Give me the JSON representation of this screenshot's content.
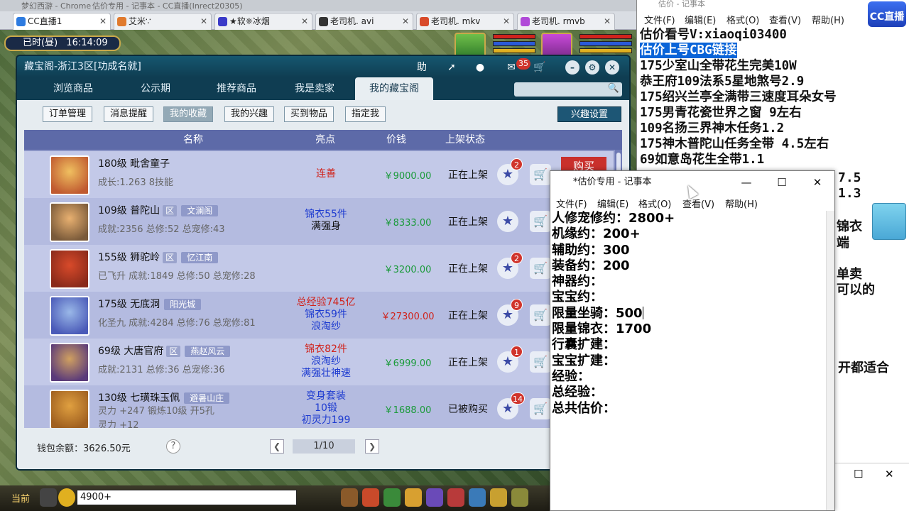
{
  "browser": {
    "top_strip": [
      "梦幻西游 - Chrome",
      "估价专用 - 记事本 - CC直播(Inrect20305)"
    ],
    "tabs": [
      {
        "label": "CC直播1",
        "active": true,
        "color": "#2d7be0"
      },
      {
        "label": "艾米∵",
        "active": false,
        "color": "#e07a2d"
      },
      {
        "label": "★软❈冰烟",
        "active": false,
        "color": "#3a3ac8"
      },
      {
        "label": "老司机. avi",
        "active": false,
        "color": "#333333"
      },
      {
        "label": "老司机. mkv",
        "active": false,
        "color": "#d84a2a"
      },
      {
        "label": "老司机. rmvb",
        "active": false,
        "color": "#b04ad8"
      }
    ]
  },
  "game_hud": {
    "time_label": "已时(昼)",
    "time_value": "16:14:09"
  },
  "cbg": {
    "title": "藏宝阁-浙江3区[功成名就]",
    "help_label": "助",
    "message_badge": "35",
    "nav_tabs": [
      "浏览商品",
      "公示期",
      "推荐商品",
      "我是卖家",
      "我的藏宝阁"
    ],
    "active_nav": 4,
    "sub_buttons": [
      "订单管理",
      "消息提醒",
      "我的收藏",
      "我的兴趣",
      "买到物品",
      "指定我"
    ],
    "active_sub": 2,
    "interest_button": "兴趣设置",
    "columns": [
      "名称",
      "亮点",
      "价钱",
      "上架状态"
    ],
    "buy_label": "购买",
    "rows": [
      {
        "name": "180级  毗舍童子",
        "school": "",
        "server": "",
        "stats": "成长:1.263  8技能",
        "highlights": [
          {
            "text": "连善",
            "color": "#d0231c"
          }
        ],
        "price": "￥9000.00",
        "price_color": "#1a9a3a",
        "status": "正在上架",
        "badge": "2",
        "buy": true
      },
      {
        "name": "109级  普陀山",
        "school": "区",
        "server": "文澜阁",
        "stats": "成就:2356  总修:52  总宠修:43",
        "highlights": [
          {
            "text": "锦衣55件",
            "color": "#1d3bd0"
          },
          {
            "text": "满强身",
            "color": "#111111"
          }
        ],
        "price": "￥8333.00",
        "price_color": "#1a9a3a",
        "status": "正在上架",
        "badge": "",
        "buy": false
      },
      {
        "name": "155级  狮驼岭",
        "school": "区",
        "server": "忆江南",
        "stats": "已飞升  成就:1849  总修:50  总宠修:28",
        "highlights": [],
        "price": "￥3200.00",
        "price_color": "#1a9a3a",
        "status": "正在上架",
        "badge": "2",
        "buy": false
      },
      {
        "name": "175级  无底洞",
        "school": "",
        "server": "阳光城",
        "stats": "化圣九  成就:4284  总修:76  总宠修:81",
        "highlights": [
          {
            "text": "总经验745亿",
            "color": "#d0231c"
          },
          {
            "text": "锦衣59件",
            "color": "#1d3bd0"
          },
          {
            "text": "浪淘纱",
            "color": "#1d3bd0"
          }
        ],
        "price": "￥27300.00",
        "price_color": "#d0231c",
        "status": "正在上架",
        "badge": "9",
        "buy": false
      },
      {
        "name": "69级  大唐官府",
        "school": "区",
        "server": "燕赵风云",
        "stats": "成就:2131  总修:36  总宠修:36",
        "highlights": [
          {
            "text": "锦衣82件",
            "color": "#d0231c"
          },
          {
            "text": "浪淘纱",
            "color": "#1d3bd0"
          },
          {
            "text": "满强壮神速",
            "color": "#1d3bd0"
          }
        ],
        "price": "￥6999.00",
        "price_color": "#1a9a3a",
        "status": "正在上架",
        "badge": "1",
        "buy": false
      },
      {
        "name": "130级  七璜珠玉佩",
        "school": "",
        "server": "避暑山庄",
        "stats": "灵力 +247  锻炼10级  开5孔",
        "stats2": "灵力 +12",
        "highlights": [
          {
            "text": "变身套装",
            "color": "#1d3bd0"
          },
          {
            "text": "10锻",
            "color": "#1d3bd0"
          },
          {
            "text": "初灵力199",
            "color": "#1d3bd0"
          }
        ],
        "price": "￥1688.00",
        "price_color": "#1a9a3a",
        "status": "已被购买",
        "badge": "14",
        "buy": false
      }
    ],
    "wallet": "钱包余额：3626.50元",
    "page": "1/10"
  },
  "chat": {
    "channel": "当前",
    "input_value": "4900+"
  },
  "big_notepad": {
    "title": "估价 - 记事本",
    "menu": [
      "文件(F)",
      "编辑(E)",
      "格式(O)",
      "查看(V)",
      "帮助(H)"
    ],
    "lines": [
      "估价看号V:xiaoqi03400",
      "估价上号CBG链接",
      "175少室山全带花生完美10W",
      "恭王府109法系5星地煞号2.9",
      "175绍兴兰亭全满带三速度耳朵女号",
      "175男青花瓷世界之窗  9左右",
      "109名扬三界神木任务1.2",
      "175神木普陀山任务全带 4.5左右",
      "69如意岛花生全带1.1"
    ],
    "fragments": [
      "7.5",
      "1.3",
      "锦衣",
      "端",
      "单卖",
      "可以的",
      "开都适合"
    ],
    "logo": "CC直播"
  },
  "notepad": {
    "title": "*估价专用 - 记事本",
    "menu": [
      "文件(F)",
      "编辑(E)",
      "格式(O)",
      "查看(V)",
      "帮助(H)"
    ],
    "lines": [
      "人修宠修约：2800+",
      "机缘约：200+",
      "辅助约：300",
      "装备约：200",
      "神器约：",
      "宝宝约：",
      "限量坐骑：500",
      "限量锦衣：1700",
      "行囊扩建：",
      "宝宝扩建：",
      "经验：",
      "总经验：",
      "总共估价："
    ]
  }
}
